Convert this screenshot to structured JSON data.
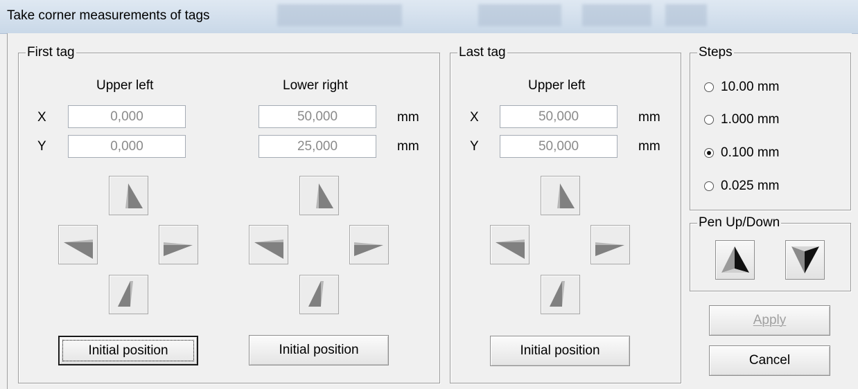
{
  "window": {
    "title": "Take corner measurements of tags"
  },
  "first_tag": {
    "legend": "First tag",
    "upper_left_heading": "Upper left",
    "lower_right_heading": "Lower right",
    "x_label": "X",
    "y_label": "Y",
    "unit": "mm",
    "upper_left_x": "0,000",
    "upper_left_y": "0,000",
    "lower_right_x": "50,000",
    "lower_right_y": "25,000",
    "initial_position_label": "Initial position"
  },
  "last_tag": {
    "legend": "Last tag",
    "upper_left_heading": "Upper left",
    "x_label": "X",
    "y_label": "Y",
    "unit": "mm",
    "upper_left_x": "50,000",
    "upper_left_y": "50,000",
    "initial_position_label": "Initial position"
  },
  "steps": {
    "legend": "Steps",
    "options": [
      "10.00 mm",
      "1.000 mm",
      "0.100 mm",
      "0.025 mm"
    ],
    "selected": "0.100 mm"
  },
  "pen": {
    "legend": "Pen Up/Down",
    "up_icon": "pen-up-icon",
    "down_icon": "pen-down-icon"
  },
  "actions": {
    "apply_label": "Apply",
    "apply_enabled": false,
    "cancel_label": "Cancel"
  },
  "icons": {
    "arrow_up": "arrow-up-icon",
    "arrow_down": "arrow-down-icon",
    "arrow_left": "arrow-left-icon",
    "arrow_right": "arrow-right-icon"
  }
}
